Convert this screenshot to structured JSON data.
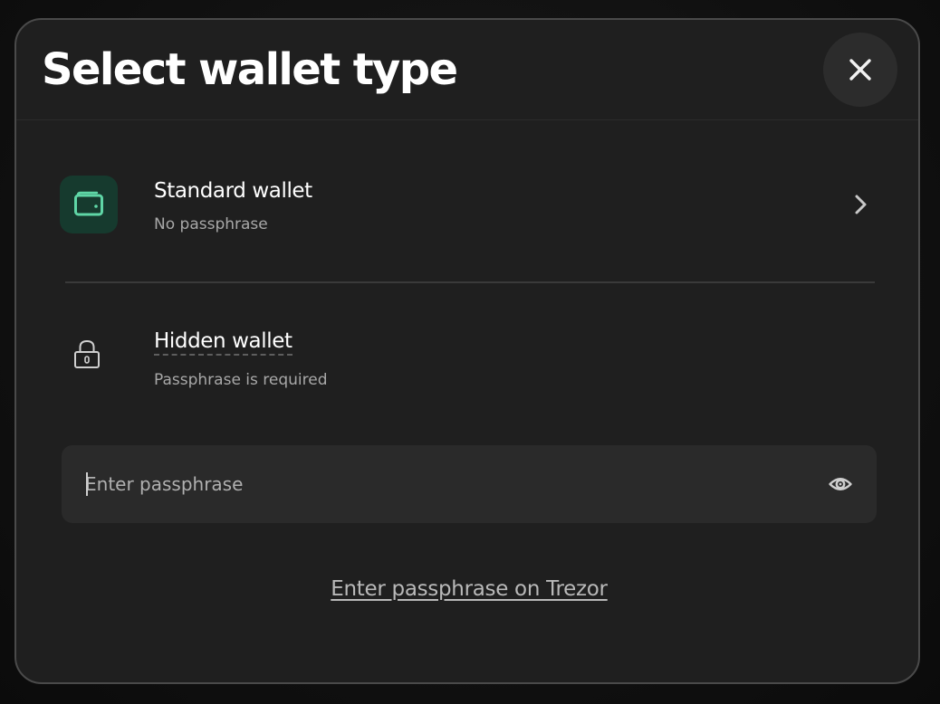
{
  "modal": {
    "title": "Select wallet type",
    "close_icon": "close-icon"
  },
  "standard_wallet": {
    "title": "Standard wallet",
    "subtitle": "No passphrase",
    "icon": "wallet-icon",
    "chevron_icon": "chevron-right-icon"
  },
  "hidden_wallet": {
    "title": "Hidden wallet",
    "subtitle": "Passphrase is required",
    "icon": "lock-icon"
  },
  "passphrase_input": {
    "value": "",
    "placeholder": "Enter passphrase",
    "toggle_icon": "eye-icon"
  },
  "trezor_link": {
    "label": "Enter passphrase on Trezor"
  },
  "colors": {
    "background": "#1f1f1f",
    "accent_green": "#4fd3a1",
    "icon_tile": "#163a2e",
    "text_primary": "#ffffff",
    "text_secondary": "#a8a8a8"
  }
}
